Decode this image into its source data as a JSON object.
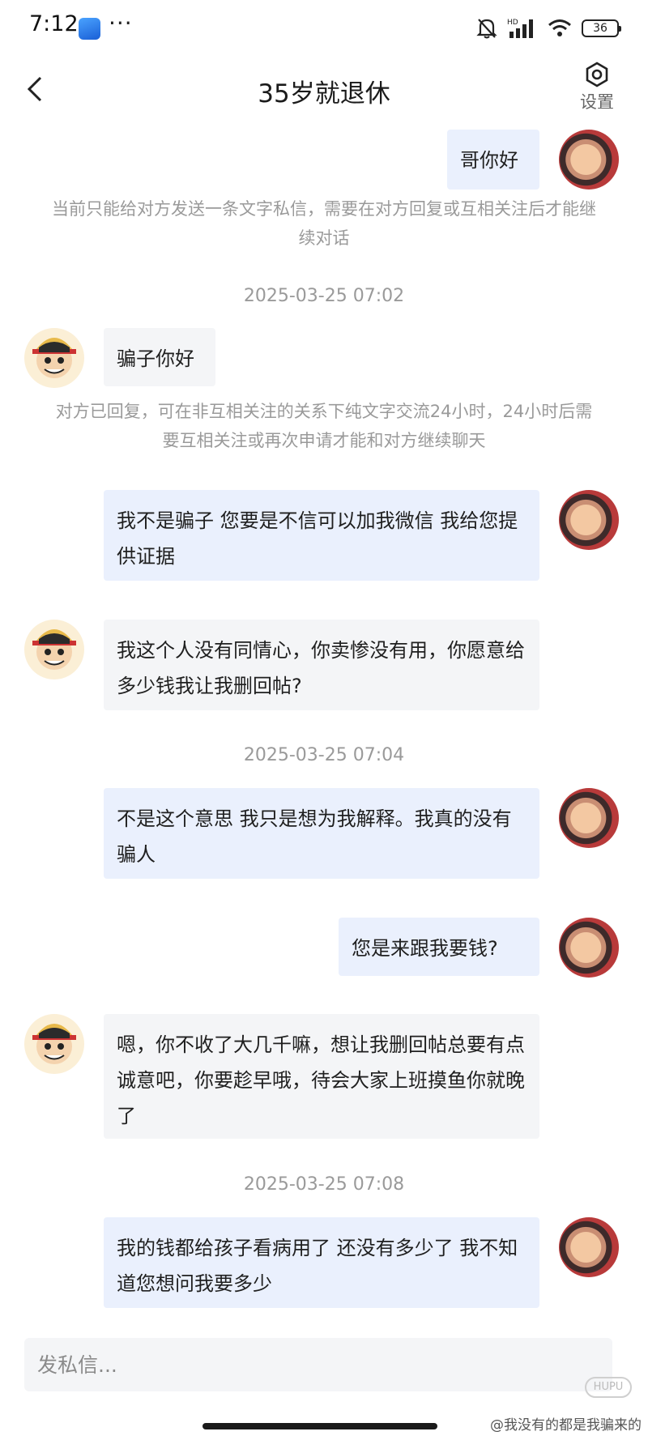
{
  "status_bar": {
    "time": "7:12",
    "more_dots": "···",
    "icons": [
      "mute-bell-icon",
      "hd-signal-icon",
      "wifi-icon",
      "battery-icon"
    ],
    "network_label": "HD",
    "battery": "36"
  },
  "header": {
    "title": "35岁就退休",
    "settings_label": "设置"
  },
  "messages": [
    {
      "type": "me",
      "text": "哥你好"
    },
    {
      "type": "notice",
      "text": "当前只能给对方发送一条文字私信，需要在对方回复或互相关注后才能继续对话"
    },
    {
      "type": "timestamp",
      "text": "2025-03-25 07:02"
    },
    {
      "type": "other",
      "text": "骗子你好"
    },
    {
      "type": "notice",
      "text": "对方已回复，可在非互相关注的关系下纯文字交流24小时，24小时后需要互相关注或再次申请才能和对方继续聊天"
    },
    {
      "type": "me",
      "text": "我不是骗子 您要是不信可以加我微信 我给您提供证据"
    },
    {
      "type": "other",
      "text": "我这个人没有同情心，你卖惨没有用，你愿意给多少钱我让我删回帖?"
    },
    {
      "type": "timestamp",
      "text": "2025-03-25 07:04"
    },
    {
      "type": "me",
      "text": "不是这个意思 我只是想为我解释。我真的没有骗人"
    },
    {
      "type": "me",
      "text": "您是来跟我要钱?"
    },
    {
      "type": "other",
      "text": "嗯，你不收了大几千嘛，想让我删回帖总要有点诚意吧，你要趁早哦，待会大家上班摸鱼你就晚了"
    },
    {
      "type": "timestamp",
      "text": "2025-03-25 07:08"
    },
    {
      "type": "me",
      "text": "我的钱都给孩子看病用了 还没有多少了 我不知道您想问我要多少"
    }
  ],
  "composer": {
    "placeholder": "发私信..."
  },
  "watermark": {
    "logo_text": "HUPU",
    "text": "@我没有的都是我骗来的"
  },
  "colors": {
    "bubble_me": "#eaf0fd",
    "bubble_other": "#f4f5f7",
    "meta_text": "#9a9a9a"
  }
}
